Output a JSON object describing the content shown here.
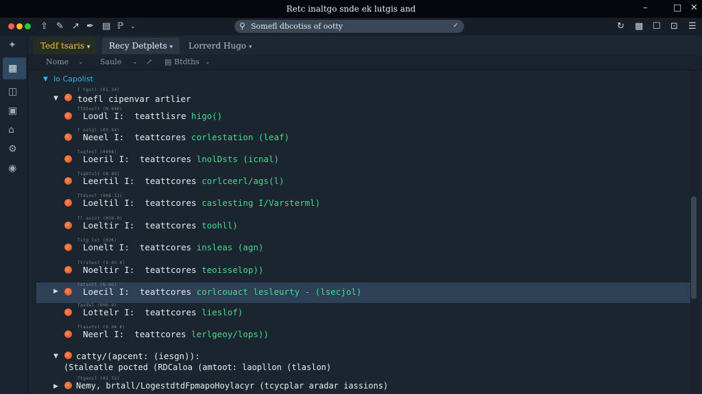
{
  "window": {
    "title": "Retc inaltgo snde ek lutgis and"
  },
  "toolbar": {
    "search_placeholder": "Somefl dbcotiss of ootty"
  },
  "tabs": [
    {
      "label": "Tedf tsaris",
      "active": true,
      "accent": "#f5c542"
    },
    {
      "label": "Recy Detplets",
      "active": false
    },
    {
      "label": "Lorrerd Hugo",
      "active": false
    }
  ],
  "filters": {
    "name": "Nome",
    "scale": "Saule",
    "status": "Btdths"
  },
  "tree": {
    "root_label": "Io Capolist",
    "group_label": "toefl cipenvar artlier",
    "rows": [
      {
        "meta": "Tthtoslt (N.04K)",
        "prefix": "Loodl I:  teattlisre",
        "func": "higo()",
        "selected": false
      },
      {
        "meta": "T ostgl (03.54)",
        "prefix": "Neeel I:  teattcores",
        "func": "corlestation (leaf)",
        "selected": false
      },
      {
        "meta": "Tsqfosl (0008)",
        "prefix": "Loeril I:  teattcores",
        "func": "lnolDsts (icnal)",
        "selected": false
      },
      {
        "meta": "Tsgbtslt (N.0G)",
        "prefix": "Leertil I:  teattcores",
        "func": "corlceerl/ags(l)",
        "selected": false
      },
      {
        "meta": "Ttdsnsl (006.11)",
        "prefix": "Loeltil I:  teattcores",
        "func": "caslesting I/Varsterml)",
        "selected": false
      },
      {
        "meta": "Tl asiot (030-0)",
        "prefix": "Loeltir I:  teattcores",
        "func": "toohll)",
        "selected": false
      },
      {
        "meta": "Tstg  lst (02K)",
        "prefix": "Lonelt I:  teattcores",
        "func": "insleas (agn)",
        "selected": false
      },
      {
        "meta": "Ttrstesl (9-03 K)",
        "prefix": "Noeltir I:  teattcores",
        "func": "teoisselop))",
        "selected": false
      },
      {
        "meta": "Tetsnlt (N.0G)",
        "prefix": "Loecil I:  teattcores",
        "func": "corlcouact lesleurty - (lsecjol)",
        "selected": true
      },
      {
        "meta": "Tasdsl (006-0)",
        "prefix": "Lottelr I:  teattcores",
        "func": "lieslof)",
        "selected": false
      },
      {
        "meta": "Tlasotsl (0.04 K)",
        "prefix": "Neerl I:  teattcores",
        "func": "lerlgeoy/lops))",
        "selected": false
      }
    ],
    "group2_head": "catty/(apcent: (iesgn)):",
    "group2_sub": "(Staleatle pocted (RDCaloa (amtoot: laopllon (tlaslon)",
    "group2_meta": "Ttgassl (03.Ts)",
    "group3": "Nemy, brtall/LogestdtdFpmapoHoylacyr (tcycplar aradar iassions)"
  },
  "colors": {
    "accent": "#38b7e8",
    "func": "#46d98f",
    "bullet": "#e45a2a",
    "selected_row": "#2e4055"
  }
}
